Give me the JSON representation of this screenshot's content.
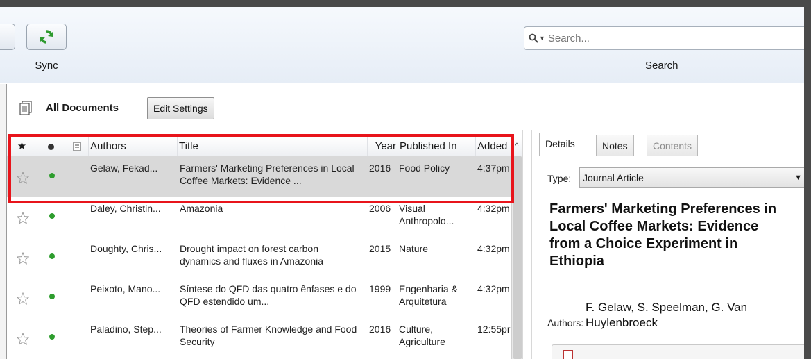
{
  "toolbar": {
    "sync_label": "Sync",
    "search_placeholder": "Search...",
    "search_label": "Search"
  },
  "library": {
    "title": "All Documents",
    "edit_settings_label": "Edit Settings"
  },
  "table": {
    "columns": [
      "Authors",
      "Title",
      "Year",
      "Published In",
      "Added"
    ],
    "rows": [
      {
        "authors": "Gelaw, Fekad...",
        "title": "Farmers' Marketing Preferences in Local Coffee Markets: Evidence ...",
        "year": "2016",
        "published_in": "Food Policy",
        "added": "4:37pm",
        "selected": true
      },
      {
        "authors": "Daley, Christin...",
        "title": "Amazonia",
        "year": "2006",
        "published_in": "Visual Anthropolo...",
        "added": "4:32pm",
        "selected": false
      },
      {
        "authors": "Doughty, Chris...",
        "title": "Drought impact on forest carbon dynamics and fluxes in Amazonia",
        "year": "2015",
        "published_in": "Nature",
        "added": "4:32pm",
        "selected": false
      },
      {
        "authors": "Peixoto, Mano...",
        "title": "Síntese do QFD das quatro ênfases e do QFD estendido um...",
        "year": "1999",
        "published_in": "Engenharia & Arquitetura",
        "added": "4:32pm",
        "selected": false
      },
      {
        "authors": "Paladino, Step...",
        "title": "Theories of Farmer Knowledge and Food Security",
        "year": "2016",
        "published_in": "Culture, Agriculture",
        "added": "12:55pr",
        "selected": false
      }
    ]
  },
  "details": {
    "tabs": [
      "Details",
      "Notes",
      "Contents"
    ],
    "type_label": "Type:",
    "type_value": "Journal Article",
    "title": "Farmers' Marketing Preferences in Local Coffee Markets: Evidence from a Choice Experiment in Ethiopia",
    "authors_label": "Authors:",
    "authors_value": "F. Gelaw, S. Speelman, G. Van Huylenbroeck"
  },
  "colors": {
    "highlight": "#e8141b",
    "read_dot": "#2e9d2e",
    "selected_row": "#d9d9d9"
  }
}
